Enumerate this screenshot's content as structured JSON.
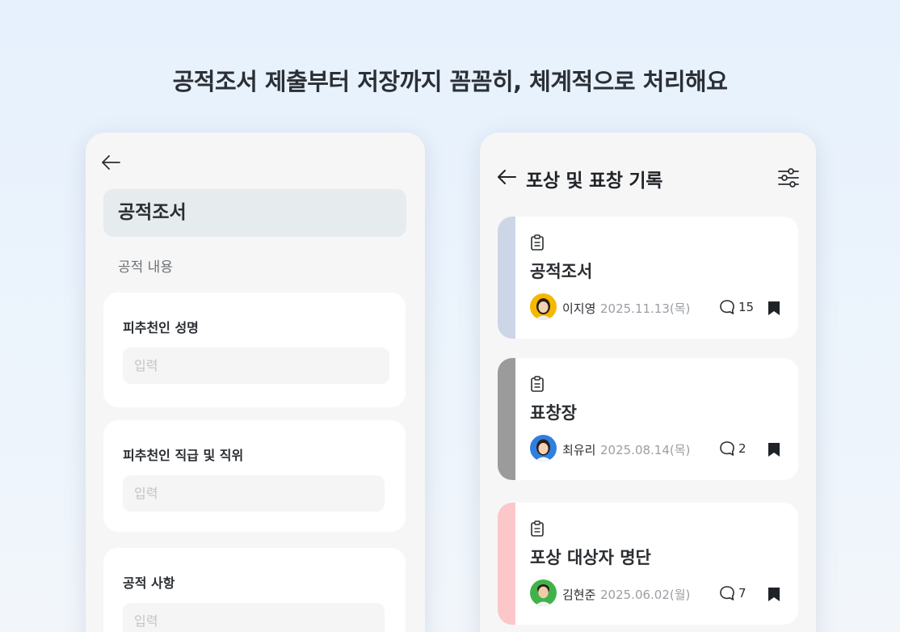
{
  "headline": "공적조서 제출부터 저장까지 꼼꼼히, 체계적으로 처리해요",
  "form": {
    "back_icon": "arrow-left-icon",
    "title": "공적조서",
    "section_label": "공적 내용",
    "fields": [
      {
        "label": "피추천인 성명",
        "placeholder": "입력",
        "value": ""
      },
      {
        "label": "피추천인 직급 및 직위",
        "placeholder": "입력",
        "value": ""
      },
      {
        "label": "공적 사항",
        "placeholder": "입력",
        "value": ""
      }
    ]
  },
  "list": {
    "back_icon": "arrow-left-icon",
    "title": "포상 및 표창 기록",
    "filter_icon": "sliders-icon",
    "records": [
      {
        "title": "공적조서",
        "author": "이지영",
        "date": "2025.11.13(목)",
        "comments": "15",
        "bar_color": "#cdd6e6",
        "avatar_color": "#f5b800"
      },
      {
        "title": "표창장",
        "author": "최유리",
        "date": "2025.08.14(목)",
        "comments": "2",
        "bar_color": "#9b9b9b",
        "avatar_color": "#2f7fe0"
      },
      {
        "title": "포상 대상자 명단",
        "author": "김현준",
        "date": "2025.06.02(월)",
        "comments": "7",
        "bar_color": "#fbc7c9",
        "avatar_color": "#3fb24a"
      }
    ]
  }
}
